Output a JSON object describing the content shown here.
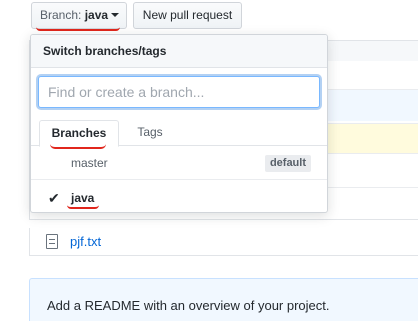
{
  "toolbar": {
    "branch_prefix": "Branch: ",
    "branch_name": "java",
    "new_pull_request_label": "New pull request"
  },
  "dropdown": {
    "header": "Switch branches/tags",
    "filter": {
      "value": "",
      "placeholder": "Find or create a branch..."
    },
    "tabs": [
      {
        "label": "Branches",
        "selected": true
      },
      {
        "label": "Tags",
        "selected": false
      }
    ],
    "items": [
      {
        "label": "master",
        "badge": "default",
        "checked": false
      },
      {
        "label": "java",
        "badge": "",
        "checked": true
      }
    ],
    "check_glyph": "✔"
  },
  "files": [
    {
      "name": "pjf.txt",
      "icon": "file-text-icon"
    }
  ],
  "readme_prompt": "Add a README with an overview of your project.",
  "colors": {
    "link": "#0366d6",
    "annotation_red": "#e1261c",
    "readme_bg": "#f1f8ff"
  }
}
